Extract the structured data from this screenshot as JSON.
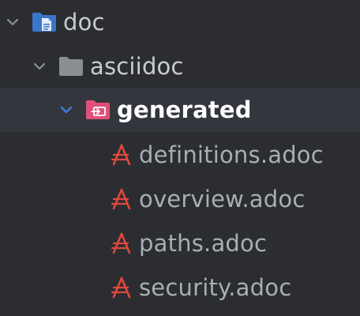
{
  "tree": {
    "root": {
      "label": "doc",
      "icon": "folder-doc-icon",
      "expanded": true,
      "children": [
        {
          "label": "asciidoc",
          "icon": "folder-icon",
          "expanded": true,
          "children": [
            {
              "label": "generated",
              "icon": "folder-generated-icon",
              "expanded": true,
              "selected": true,
              "children": [
                {
                  "label": "definitions.adoc",
                  "icon": "asciidoc-icon"
                },
                {
                  "label": "overview.adoc",
                  "icon": "asciidoc-icon"
                },
                {
                  "label": "paths.adoc",
                  "icon": "asciidoc-icon"
                },
                {
                  "label": "security.adoc",
                  "icon": "asciidoc-icon"
                }
              ]
            }
          ]
        }
      ]
    }
  },
  "colors": {
    "background": "#2b2d31",
    "selected_row": "#33363c",
    "chevron": "#8c9096",
    "chevron_selected": "#3d7fe0",
    "doc_folder": "#3b76c9",
    "folder": "#8a8d92",
    "generated_folder": "#e0507a",
    "asciidoc_icon": "#e0483e"
  }
}
